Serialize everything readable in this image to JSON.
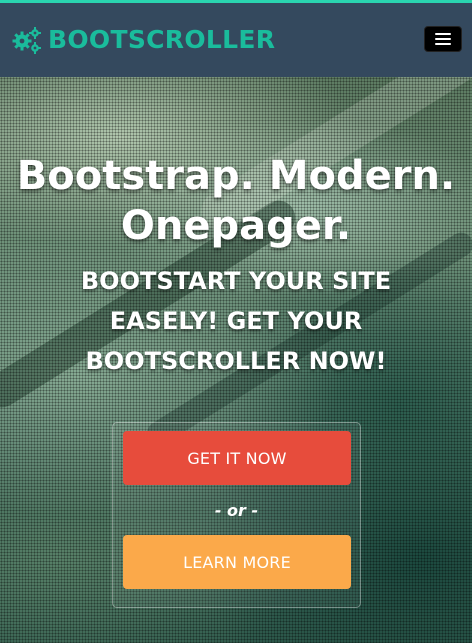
{
  "navbar": {
    "brand": "BOOTSCROLLER",
    "brand_icon": "gears-icon",
    "menu_icon": "hamburger-menu-icon"
  },
  "hero": {
    "headline": "Bootstrap. Modern. Onepager.",
    "subheadline": "BOOTSTART YOUR SITE EASELY! GET YOUR BOOTSCROLLER NOW!",
    "primary_button": "GET IT NOW",
    "separator": "- or -",
    "secondary_button": "LEARN MORE"
  },
  "colors": {
    "top_stripe": "#2ad5b0",
    "navbar_bg": "#34495e",
    "brand": "#1abc9c",
    "primary_button": "#e74c3c",
    "secondary_button": "#fba94a"
  }
}
